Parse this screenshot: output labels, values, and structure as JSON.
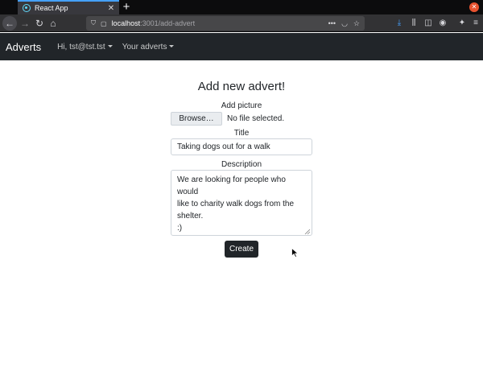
{
  "browser": {
    "tab_title": "React App",
    "tab_close": "✕",
    "new_tab": "+",
    "url_host": "localhost",
    "url_path": ":3001/add-advert",
    "url_more": "•••"
  },
  "navbar": {
    "brand": "Adverts",
    "user_menu": "Hi, tst@tst.tst",
    "adverts_menu": "Your adverts"
  },
  "form": {
    "heading": "Add new advert!",
    "picture_label": "Add picture",
    "browse_button": "Browse…",
    "file_status": "No file selected.",
    "title_label": "Title",
    "title_value": "Taking dogs out for a walk",
    "description_label": "Description",
    "description_value": "We are looking for people who would\nlike to charity walk dogs from the shelter.\n:)",
    "submit_label": "Create"
  },
  "colors": {
    "navbar_bg": "#212529",
    "button_bg": "#212529",
    "tab_accent": "#45a1ff"
  },
  "icons": [
    "react-favicon-icon",
    "back-arrow-icon",
    "forward-arrow-icon",
    "reload-icon",
    "home-icon",
    "shield-icon",
    "page-icon",
    "pocket-icon",
    "bookmark-star-icon",
    "download-icon",
    "library-icon",
    "sidebar-icon",
    "account-icon",
    "extension-icon",
    "hamburger-menu-icon",
    "mouse-cursor-icon"
  ]
}
